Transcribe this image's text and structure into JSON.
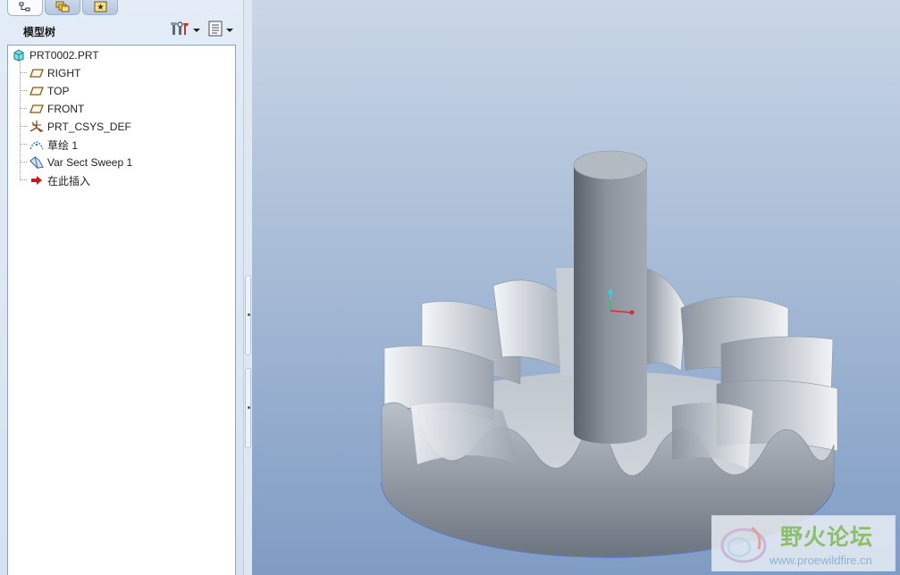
{
  "tabs": [
    {
      "name": "model-tree",
      "icon": "model-tree-icon",
      "active": true
    },
    {
      "name": "layers",
      "icon": "layers-icon",
      "active": false
    },
    {
      "name": "favorites",
      "icon": "favorites-icon",
      "active": false
    }
  ],
  "tree": {
    "title": "模型树",
    "settings_icon": "tree-settings-icon",
    "show_icon": "tree-columns-icon",
    "items": [
      {
        "label": "PRT0002.PRT",
        "icon": "part-icon"
      },
      {
        "label": "RIGHT",
        "icon": "datum-plane-icon"
      },
      {
        "label": "TOP",
        "icon": "datum-plane-icon"
      },
      {
        "label": "FRONT",
        "icon": "datum-plane-icon"
      },
      {
        "label": "PRT_CSYS_DEF",
        "icon": "csys-icon"
      },
      {
        "label": "草绘 1",
        "icon": "sketch-icon"
      },
      {
        "label": "Var Sect Sweep 1",
        "icon": "sweep-icon"
      },
      {
        "label": "在此插入",
        "icon": "insert-arrow-icon"
      }
    ]
  },
  "watermark": {
    "title": "野火论坛",
    "url": "www.proewildfire.cn"
  },
  "colors": {
    "viewport_top": "#c9d6e6",
    "viewport_bottom": "#7f9cc4",
    "model_gray": "#a9b0ba",
    "edge_highlight": "#2f55ff",
    "watermark_green": "#8dbf6a"
  }
}
